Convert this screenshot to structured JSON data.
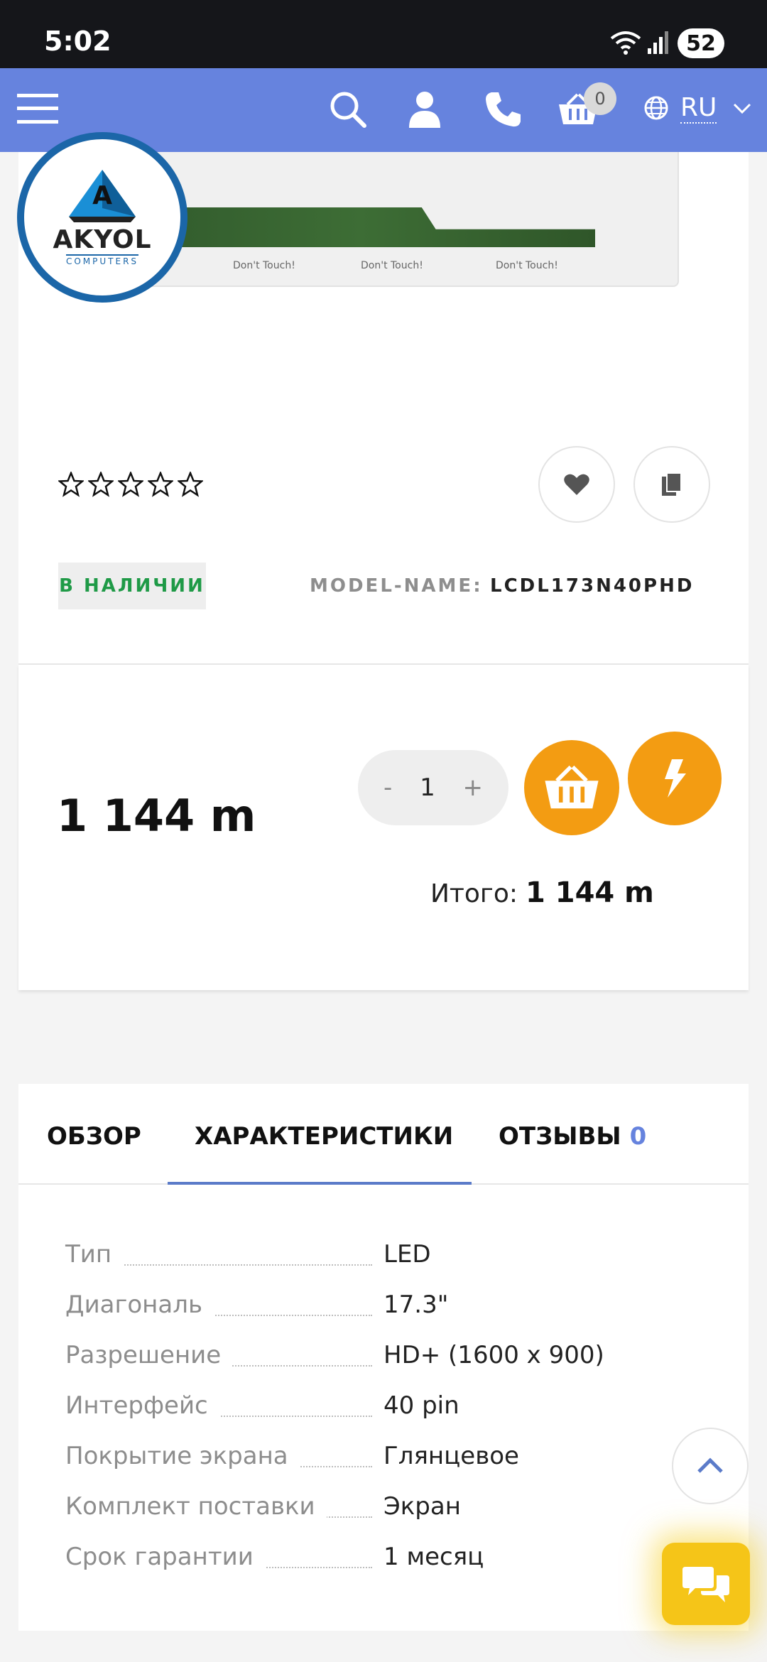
{
  "status_bar": {
    "time": "5:02",
    "battery": "52"
  },
  "header": {
    "cart_count": "0",
    "language": "RU",
    "icons": [
      "menu-icon",
      "search-icon",
      "user-icon",
      "phone-icon",
      "cart-icon",
      "globe-icon",
      "chevron-down-icon"
    ],
    "background": "#6683de"
  },
  "product_image": {
    "logo_text": "AKYOL",
    "logo_subtext": "COMPUTERS",
    "panel_labels": [
      "Don't Touch!",
      "Don't Touch!",
      "Don't Touch!"
    ]
  },
  "product": {
    "rating_stars": 5,
    "rating_value": 0,
    "stock_label": "В НАЛИЧИИ",
    "model_label": "MODEL-NAME:",
    "model_value": "LCDL173N40PHD"
  },
  "purchase": {
    "price": "1 144 m",
    "qty_minus": "-",
    "qty_value": "1",
    "qty_plus": "+",
    "total_label": "Итого:",
    "total_value": "1 144 m",
    "accent_color": "#f39c12"
  },
  "tabs": {
    "overview": "ОБЗОР",
    "specs": "ХАРАКТЕРИСТИКИ",
    "reviews": "ОТЗЫВЫ",
    "reviews_count": "0",
    "active": "specs"
  },
  "specs": [
    {
      "name": "Тип",
      "value": "LED"
    },
    {
      "name": "Диагональ",
      "value": "17.3\""
    },
    {
      "name": "Разрешение",
      "value": "HD+ (1600 x 900)"
    },
    {
      "name": "Интерфейс",
      "value": "40 pin"
    },
    {
      "name": "Покрытие экрана",
      "value": "Глянцевое"
    },
    {
      "name": "Комплект поставки",
      "value": "Экран"
    },
    {
      "name": "Срок гарантии",
      "value": "1 месяц"
    }
  ]
}
